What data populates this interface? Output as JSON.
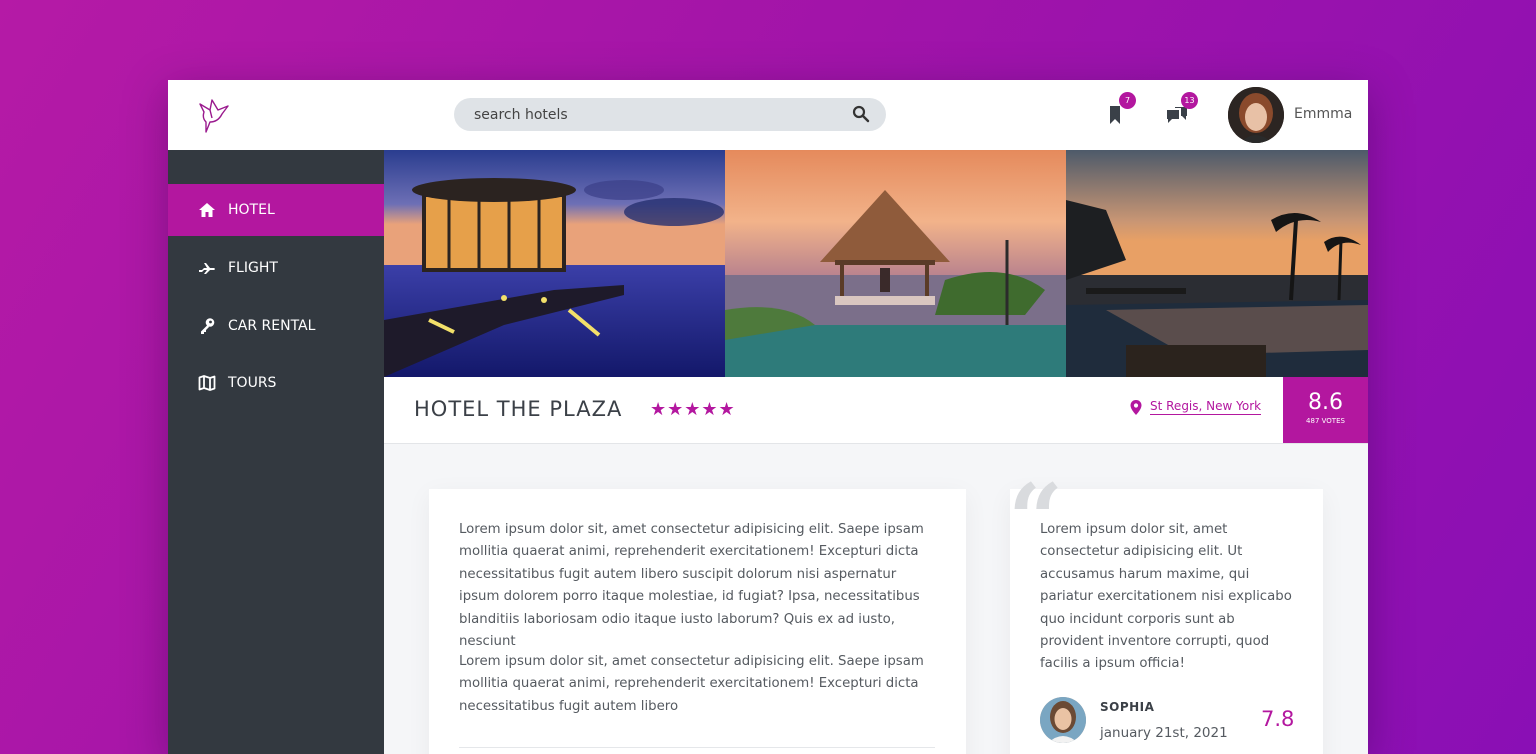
{
  "brand": {
    "accent": "#b3179f",
    "sidebar_bg": "#333940"
  },
  "header": {
    "search_placeholder": "search hotels",
    "bookmarks_count": "7",
    "messages_count": "13",
    "username": "Emmma"
  },
  "sidebar": {
    "items": [
      {
        "label": "HOTEL",
        "icon": "home-icon",
        "active": true
      },
      {
        "label": "FLIGHT",
        "icon": "plane-icon",
        "active": false
      },
      {
        "label": "CAR RENTAL",
        "icon": "key-icon",
        "active": false
      },
      {
        "label": "TOURS",
        "icon": "map-icon",
        "active": false
      }
    ]
  },
  "hotel": {
    "name": "HOTEL THE PLAZA",
    "stars": "★★★★★",
    "location": "St Regis, New York",
    "score": "8.6",
    "votes": "487 VOTES"
  },
  "description": {
    "paragraphs": [
      "Lorem ipsum dolor sit, amet consectetur adipisicing elit. Saepe ipsam mollitia quaerat animi, reprehenderit exercitationem! Excepturi dicta necessitatibus fugit autem libero suscipit dolorum nisi aspernatur ipsum dolorem porro itaque molestiae, id fugiat? Ipsa, necessitatibus blanditiis laboriosam odio itaque iusto laborum? Quis ex ad iusto, nesciunt",
      "Lorem ipsum dolor sit, amet consectetur adipisicing elit. Saepe ipsam mollitia quaerat animi, reprehenderit exercitationem! Excepturi dicta necessitatibus fugit autem libero"
    ]
  },
  "review": {
    "text": "Lorem ipsum dolor sit, amet consectetur adipisicing elit. Ut accusamus harum maxime, qui pariatur exercitationem nisi explicabo quo incidunt corporis sunt ab provident inventore corrupti, quod facilis a ipsum officia!",
    "reviewer": "SOPHIA",
    "date": "january 21st, 2021",
    "score": "7.8"
  }
}
